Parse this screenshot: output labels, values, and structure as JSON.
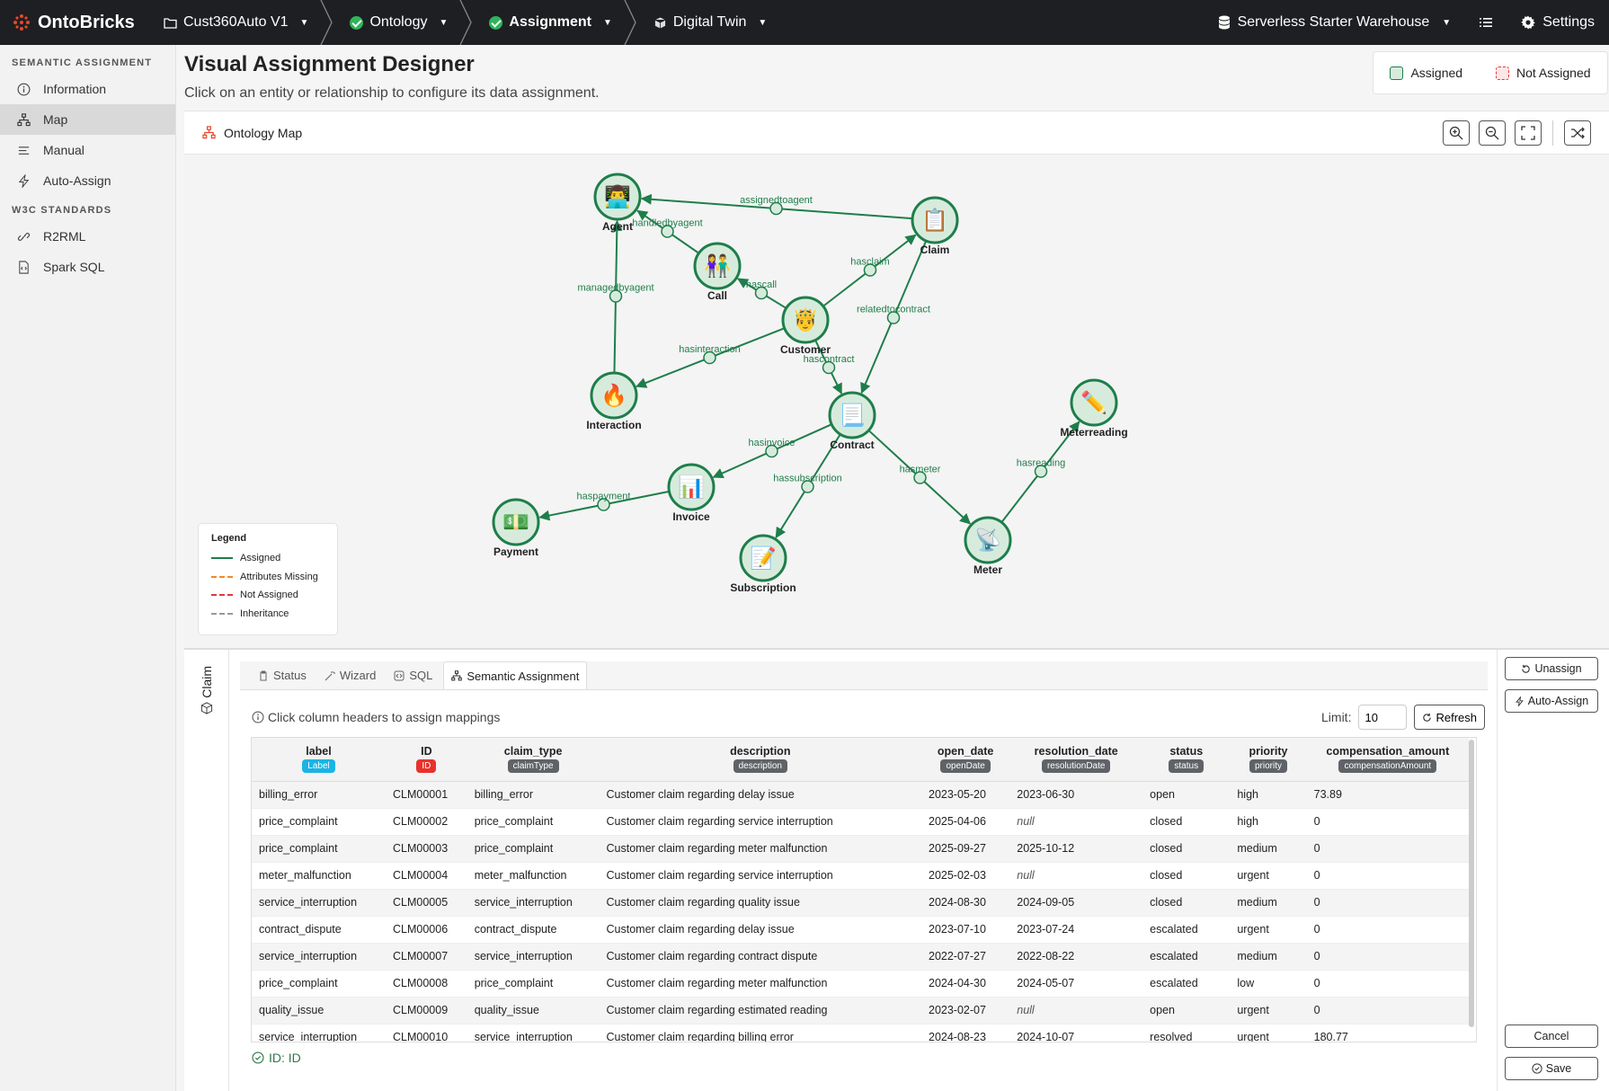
{
  "topbar": {
    "brand": "OntoBricks",
    "crumbs": [
      "Cust360Auto V1",
      "Ontology",
      "Assignment",
      "Digital Twin"
    ],
    "warehouse": "Serverless Starter Warehouse",
    "settings": "Settings"
  },
  "sidebar": {
    "section1": "SEMANTIC ASSIGNMENT",
    "items1": [
      "Information",
      "Map",
      "Manual",
      "Auto-Assign"
    ],
    "section2": "W3C STANDARDS",
    "items2": [
      "R2RML",
      "Spark SQL"
    ]
  },
  "header": {
    "title": "Visual Assignment Designer",
    "subtitle": "Click on an entity or relationship to configure its data assignment."
  },
  "status_legend": {
    "assigned": "Assigned",
    "not_assigned": "Not Assigned"
  },
  "colors": {
    "assigned": "#1e7e4a",
    "node_fill": "#d7ebdd",
    "attributes_missing": "#f08a24",
    "not_assigned": "#e0383e",
    "inheritance": "#999999",
    "label_badge": "#1ab4e6",
    "id_badge": "#e8322b",
    "col_badge": "#5f6368"
  },
  "map": {
    "title": "Ontology Map",
    "nodes": [
      {
        "id": "agent",
        "label": "Agent",
        "icon": "👨‍💻"
      },
      {
        "id": "claim",
        "label": "Claim",
        "icon": "📋"
      },
      {
        "id": "call",
        "label": "Call",
        "icon": "👫"
      },
      {
        "id": "customer",
        "label": "Customer",
        "icon": "🤴"
      },
      {
        "id": "interaction",
        "label": "Interaction",
        "icon": "🔥"
      },
      {
        "id": "contract",
        "label": "Contract",
        "icon": "📃"
      },
      {
        "id": "meterreading",
        "label": "Meterreading",
        "icon": "✏️"
      },
      {
        "id": "invoice",
        "label": "Invoice",
        "icon": "📊"
      },
      {
        "id": "payment",
        "label": "Payment",
        "icon": "💵"
      },
      {
        "id": "subscription",
        "label": "Subscription",
        "icon": "📝"
      },
      {
        "id": "meter",
        "label": "Meter",
        "icon": "📡"
      }
    ],
    "edges": [
      {
        "from": "claim",
        "to": "agent",
        "label": "assignedtoagent"
      },
      {
        "from": "call",
        "to": "agent",
        "label": "handledbyagent"
      },
      {
        "from": "interaction",
        "to": "agent",
        "label": "managedbyagent"
      },
      {
        "from": "customer",
        "to": "call",
        "label": "hascall"
      },
      {
        "from": "customer",
        "to": "claim",
        "label": "hasclaim"
      },
      {
        "from": "claim",
        "to": "contract",
        "label": "relatedtocontract"
      },
      {
        "from": "customer",
        "to": "interaction",
        "label": "hasinteraction"
      },
      {
        "from": "customer",
        "to": "contract",
        "label": "hascontract"
      },
      {
        "from": "contract",
        "to": "invoice",
        "label": "hasinvoice"
      },
      {
        "from": "invoice",
        "to": "payment",
        "label": "haspayment"
      },
      {
        "from": "contract",
        "to": "subscription",
        "label": "hassubscription"
      },
      {
        "from": "contract",
        "to": "meter",
        "label": "hasmeter"
      },
      {
        "from": "meter",
        "to": "meterreading",
        "label": "hasreading"
      }
    ],
    "legend": {
      "title": "Legend",
      "items": [
        {
          "label": "Assigned",
          "style": "solid",
          "color": "#1e7e4a"
        },
        {
          "label": "Attributes Missing",
          "style": "dashed",
          "color": "#f08a24"
        },
        {
          "label": "Not Assigned",
          "style": "dashed",
          "color": "#e0383e"
        },
        {
          "label": "Inheritance",
          "style": "dashed",
          "color": "#999999"
        }
      ]
    }
  },
  "panel": {
    "entity": "Claim",
    "tabs": [
      "Status",
      "Wizard",
      "SQL",
      "Semantic Assignment"
    ],
    "hint": "Click column headers to assign mappings",
    "limit_label": "Limit:",
    "limit_value": "10",
    "refresh": "Refresh",
    "columns": [
      {
        "name": "label",
        "badge": "Label",
        "badge_color": "#1ab4e6"
      },
      {
        "name": "ID",
        "badge": "ID",
        "badge_color": "#e8322b"
      },
      {
        "name": "claim_type",
        "badge": "claimType",
        "badge_color": "#5f6368"
      },
      {
        "name": "description",
        "badge": "description",
        "badge_color": "#5f6368"
      },
      {
        "name": "open_date",
        "badge": "openDate",
        "badge_color": "#5f6368"
      },
      {
        "name": "resolution_date",
        "badge": "resolutionDate",
        "badge_color": "#5f6368"
      },
      {
        "name": "status",
        "badge": "status",
        "badge_color": "#5f6368"
      },
      {
        "name": "priority",
        "badge": "priority",
        "badge_color": "#5f6368"
      },
      {
        "name": "compensation_amount",
        "badge": "compensationAmount",
        "badge_color": "#5f6368"
      }
    ],
    "rows": [
      [
        "billing_error",
        "CLM00001",
        "billing_error",
        "Customer claim regarding delay issue",
        "2023-05-20",
        "2023-06-30",
        "open",
        "high",
        "73.89"
      ],
      [
        "price_complaint",
        "CLM00002",
        "price_complaint",
        "Customer claim regarding service interruption",
        "2025-04-06",
        "null",
        "closed",
        "high",
        "0"
      ],
      [
        "price_complaint",
        "CLM00003",
        "price_complaint",
        "Customer claim regarding meter malfunction",
        "2025-09-27",
        "2025-10-12",
        "closed",
        "medium",
        "0"
      ],
      [
        "meter_malfunction",
        "CLM00004",
        "meter_malfunction",
        "Customer claim regarding service interruption",
        "2025-02-03",
        "null",
        "closed",
        "urgent",
        "0"
      ],
      [
        "service_interruption",
        "CLM00005",
        "service_interruption",
        "Customer claim regarding quality issue",
        "2024-08-30",
        "2024-09-05",
        "closed",
        "medium",
        "0"
      ],
      [
        "contract_dispute",
        "CLM00006",
        "contract_dispute",
        "Customer claim regarding delay issue",
        "2023-07-10",
        "2023-07-24",
        "escalated",
        "urgent",
        "0"
      ],
      [
        "service_interruption",
        "CLM00007",
        "service_interruption",
        "Customer claim regarding contract dispute",
        "2022-07-27",
        "2022-08-22",
        "escalated",
        "medium",
        "0"
      ],
      [
        "price_complaint",
        "CLM00008",
        "price_complaint",
        "Customer claim regarding meter malfunction",
        "2024-04-30",
        "2024-05-07",
        "escalated",
        "low",
        "0"
      ],
      [
        "quality_issue",
        "CLM00009",
        "quality_issue",
        "Customer claim regarding estimated reading",
        "2023-02-07",
        "null",
        "open",
        "urgent",
        "0"
      ],
      [
        "service_interruption",
        "CLM00010",
        "service_interruption",
        "Customer claim regarding billing error",
        "2024-08-23",
        "2024-10-07",
        "resolved",
        "urgent",
        "180.77"
      ]
    ],
    "id_note": "ID: ID",
    "actions": {
      "unassign": "Unassign",
      "auto_assign": "Auto-Assign",
      "cancel": "Cancel",
      "save": "Save"
    }
  }
}
